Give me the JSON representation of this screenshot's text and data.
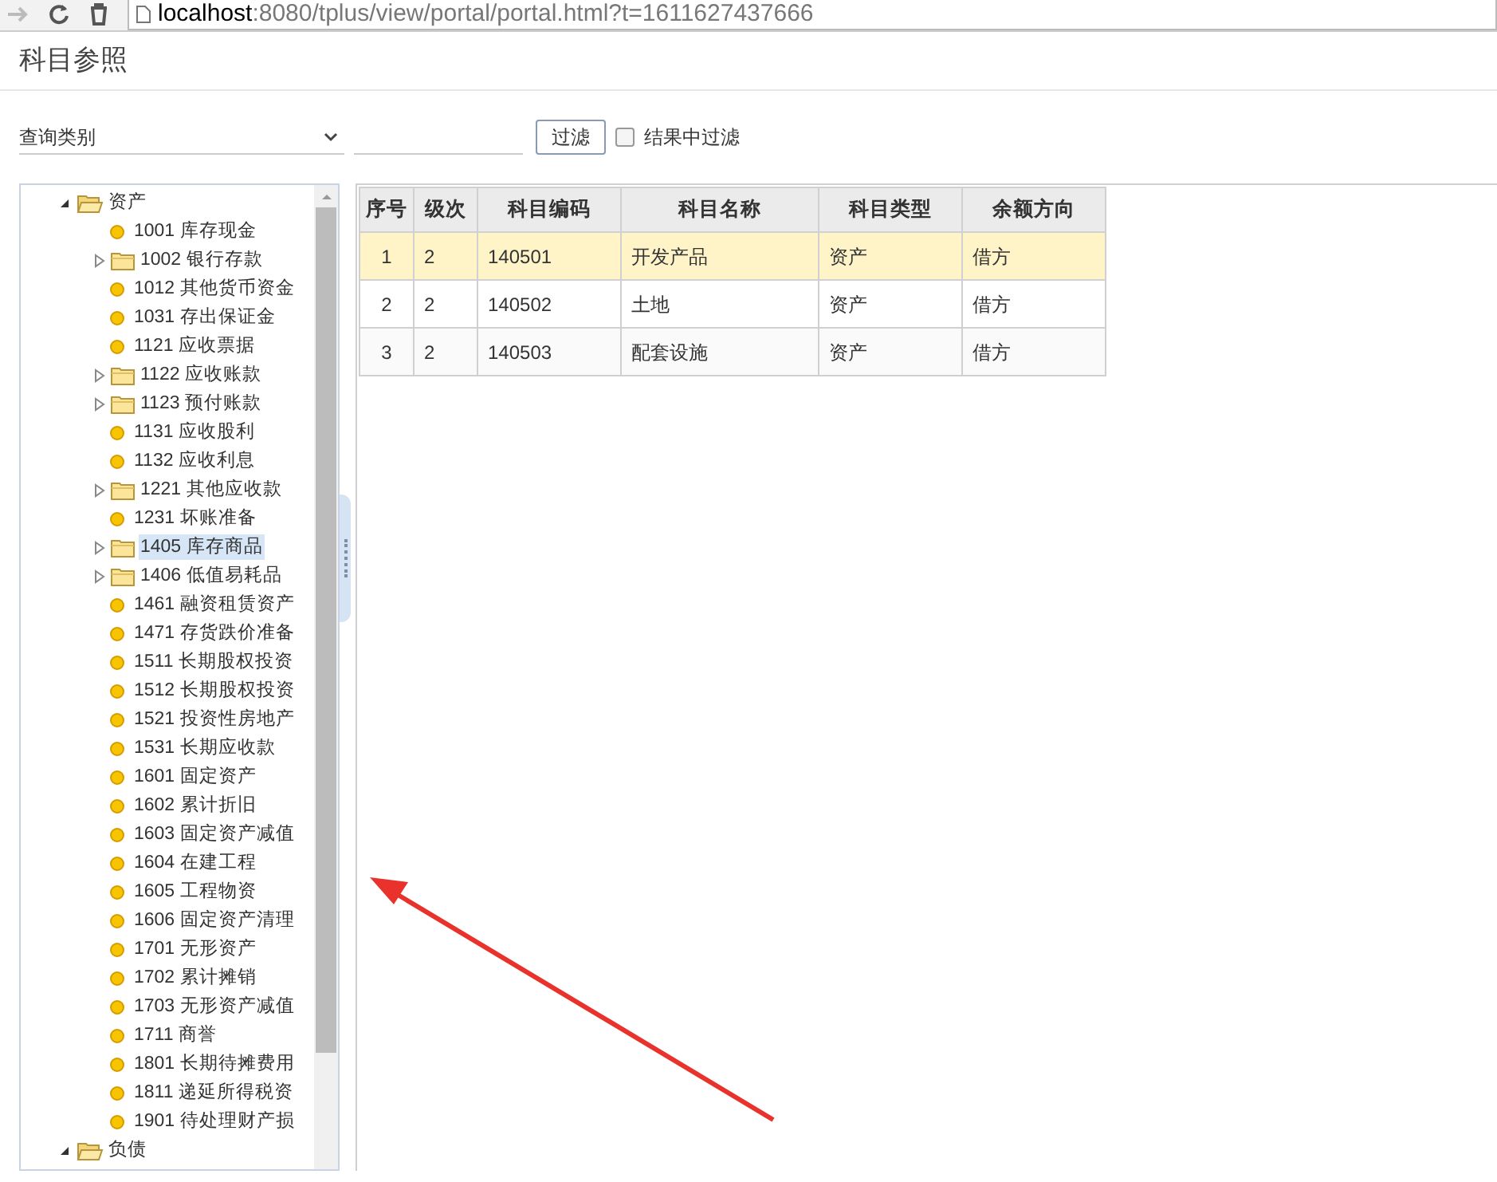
{
  "browser": {
    "url_host": "localhost",
    "url_rest": ":8080/tplus/view/portal/portal.html?t=1611627437666"
  },
  "dialog": {
    "title": "科目参照"
  },
  "filter": {
    "category": "查询类别",
    "button": "过滤",
    "in_results": {
      "label": "结果中过滤",
      "checked": false
    }
  },
  "tree": [
    {
      "label": "资产",
      "kind": "group",
      "expanded": true,
      "selected": false,
      "children": [
        {
          "label": "1001 库存现金",
          "kind": "leaf",
          "selected": false
        },
        {
          "label": "1002 银行存款",
          "kind": "folder",
          "expanded": false,
          "selected": false
        },
        {
          "label": "1012 其他货币资金",
          "kind": "leaf",
          "selected": false
        },
        {
          "label": "1031 存出保证金",
          "kind": "leaf",
          "selected": false
        },
        {
          "label": "1121 应收票据",
          "kind": "leaf",
          "selected": false
        },
        {
          "label": "1122 应收账款",
          "kind": "folder",
          "expanded": false,
          "selected": false
        },
        {
          "label": "1123 预付账款",
          "kind": "folder",
          "expanded": false,
          "selected": false
        },
        {
          "label": "1131 应收股利",
          "kind": "leaf",
          "selected": false
        },
        {
          "label": "1132 应收利息",
          "kind": "leaf",
          "selected": false
        },
        {
          "label": "1221 其他应收款",
          "kind": "folder",
          "expanded": false,
          "selected": false
        },
        {
          "label": "1231 坏账准备",
          "kind": "leaf",
          "selected": false
        },
        {
          "label": "1405 库存商品",
          "kind": "folder",
          "expanded": false,
          "selected": true
        },
        {
          "label": "1406 低值易耗品",
          "kind": "folder",
          "expanded": false,
          "selected": false
        },
        {
          "label": "1461 融资租赁资产",
          "kind": "leaf",
          "selected": false
        },
        {
          "label": "1471 存货跌价准备",
          "kind": "leaf",
          "selected": false
        },
        {
          "label": "1511 长期股权投资",
          "kind": "leaf",
          "selected": false
        },
        {
          "label": "1512 长期股权投资",
          "kind": "leaf",
          "selected": false
        },
        {
          "label": "1521 投资性房地产",
          "kind": "leaf",
          "selected": false
        },
        {
          "label": "1531 长期应收款",
          "kind": "leaf",
          "selected": false
        },
        {
          "label": "1601 固定资产",
          "kind": "leaf",
          "selected": false
        },
        {
          "label": "1602 累计折旧",
          "kind": "leaf",
          "selected": false
        },
        {
          "label": "1603 固定资产减值",
          "kind": "leaf",
          "selected": false
        },
        {
          "label": "1604 在建工程",
          "kind": "leaf",
          "selected": false
        },
        {
          "label": "1605 工程物资",
          "kind": "leaf",
          "selected": false
        },
        {
          "label": "1606 固定资产清理",
          "kind": "leaf",
          "selected": false
        },
        {
          "label": "1701 无形资产",
          "kind": "leaf",
          "selected": false
        },
        {
          "label": "1702 累计摊销",
          "kind": "leaf",
          "selected": false
        },
        {
          "label": "1703 无形资产减值",
          "kind": "leaf",
          "selected": false
        },
        {
          "label": "1711 商誉",
          "kind": "leaf",
          "selected": false
        },
        {
          "label": "1801 长期待摊费用",
          "kind": "leaf",
          "selected": false
        },
        {
          "label": "1811 递延所得税资",
          "kind": "leaf",
          "selected": false
        },
        {
          "label": "1901 待处理财产损",
          "kind": "leaf",
          "selected": false
        }
      ]
    },
    {
      "label": "负债",
      "kind": "group",
      "expanded": true,
      "selected": false
    }
  ],
  "table": {
    "columns": [
      "序号",
      "级次",
      "科目编码",
      "科目名称",
      "科目类型",
      "余额方向"
    ],
    "rows": [
      {
        "cells": [
          "1",
          "2",
          "140501",
          "开发产品",
          "资产",
          "借方"
        ],
        "selected": true
      },
      {
        "cells": [
          "2",
          "2",
          "140502",
          "土地",
          "资产",
          "借方"
        ],
        "selected": false
      },
      {
        "cells": [
          "3",
          "2",
          "140503",
          "配套设施",
          "资产",
          "借方"
        ],
        "selected": false
      }
    ]
  }
}
